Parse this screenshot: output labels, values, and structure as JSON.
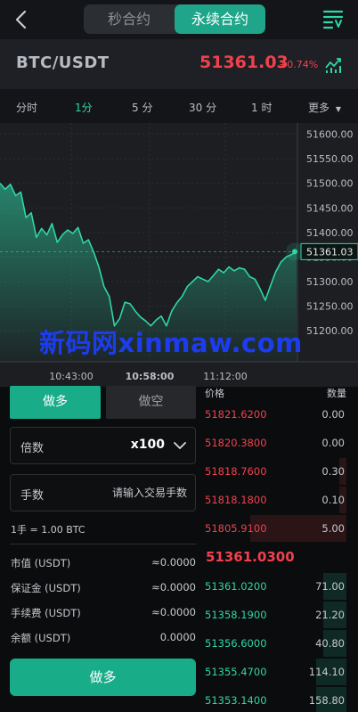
{
  "header": {
    "tabs": [
      {
        "label": "秒合约",
        "active": false
      },
      {
        "label": "永续合约",
        "active": true
      }
    ],
    "icons": {
      "back": "back-chevron-icon",
      "menu": "menu-filter-icon"
    }
  },
  "ticker": {
    "symbol": "BTC/USDT",
    "price": "51361.03",
    "change": "+0.74%",
    "price_color": "#f0414d",
    "icon": "kline-chart-icon"
  },
  "timeframes": [
    {
      "label": "分时",
      "active": false
    },
    {
      "label": "1分",
      "active": true
    },
    {
      "label": "5 分",
      "active": false
    },
    {
      "label": "30 分",
      "active": false
    },
    {
      "label": "1 时",
      "active": false
    },
    {
      "label": "更多",
      "active": false
    }
  ],
  "chart_data": {
    "type": "area",
    "y_ticks": [
      "51600.00",
      "51550.00",
      "51500.00",
      "51450.00",
      "51400.00",
      "51350.00",
      "51300.00",
      "51250.00",
      "51200.00"
    ],
    "x_ticks": [
      "10:43:00",
      "10:58:00",
      "11:12:00"
    ],
    "ylim": [
      51175,
      51610
    ],
    "last_price_label": "51361.03",
    "line_color": "#2fd6a7",
    "values": [
      51500,
      51488,
      51498,
      51475,
      51482,
      51430,
      51440,
      51390,
      51408,
      51395,
      51418,
      51380,
      51395,
      51405,
      51398,
      51410,
      51378,
      51385,
      51360,
      51330,
      51290,
      51270,
      51210,
      51225,
      51258,
      51255,
      51240,
      51228,
      51220,
      51210,
      51222,
      51230,
      51210,
      51240,
      51257,
      51270,
      51290,
      51300,
      51310,
      51305,
      51300,
      51312,
      51325,
      51318,
      51330,
      51322,
      51328,
      51325,
      51310,
      51305,
      51285,
      51262,
      51292,
      51320,
      51340,
      51350,
      51355,
      51361
    ]
  },
  "watermark": "新码网xinmaw.com",
  "trade": {
    "long_tab": "做多",
    "short_tab": "做空",
    "leverage_label": "倍数",
    "leverage_value": "x100",
    "lots_label": "手数",
    "lots_placeholder": "请输入交易手数",
    "lot_info": "1手 = 1.00 BTC",
    "rows": [
      {
        "label": "市值 (USDT)",
        "value": "≈0.0000"
      },
      {
        "label": "保证金 (USDT)",
        "value": "≈0.0000"
      },
      {
        "label": "手续费 (USDT)",
        "value": "≈0.0000"
      },
      {
        "label": "余额 (USDT)",
        "value": "0.0000"
      }
    ],
    "submit_label": "做多"
  },
  "orderbook": {
    "price_header": "价格",
    "qty_header": "数量",
    "asks": [
      {
        "price": "51821.6200",
        "qty": "0.00",
        "depth": 0
      },
      {
        "price": "51820.3800",
        "qty": "0.00",
        "depth": 0
      },
      {
        "price": "51818.7600",
        "qty": "0.30",
        "depth": 0.05
      },
      {
        "price": "51818.1800",
        "qty": "0.10",
        "depth": 0.05
      },
      {
        "price": "51805.9100",
        "qty": "5.00",
        "depth": 0.66
      }
    ],
    "last_price": "51361.0300",
    "bids": [
      {
        "price": "51361.0200",
        "qty": "71.00",
        "depth": 0.16
      },
      {
        "price": "51358.1900",
        "qty": "21.20",
        "depth": 0.16
      },
      {
        "price": "51356.6000",
        "qty": "40.80",
        "depth": 0.16
      },
      {
        "price": "51355.4700",
        "qty": "114.10",
        "depth": 0.21
      },
      {
        "price": "51353.1400",
        "qty": "158.80",
        "depth": 0.21
      }
    ]
  }
}
